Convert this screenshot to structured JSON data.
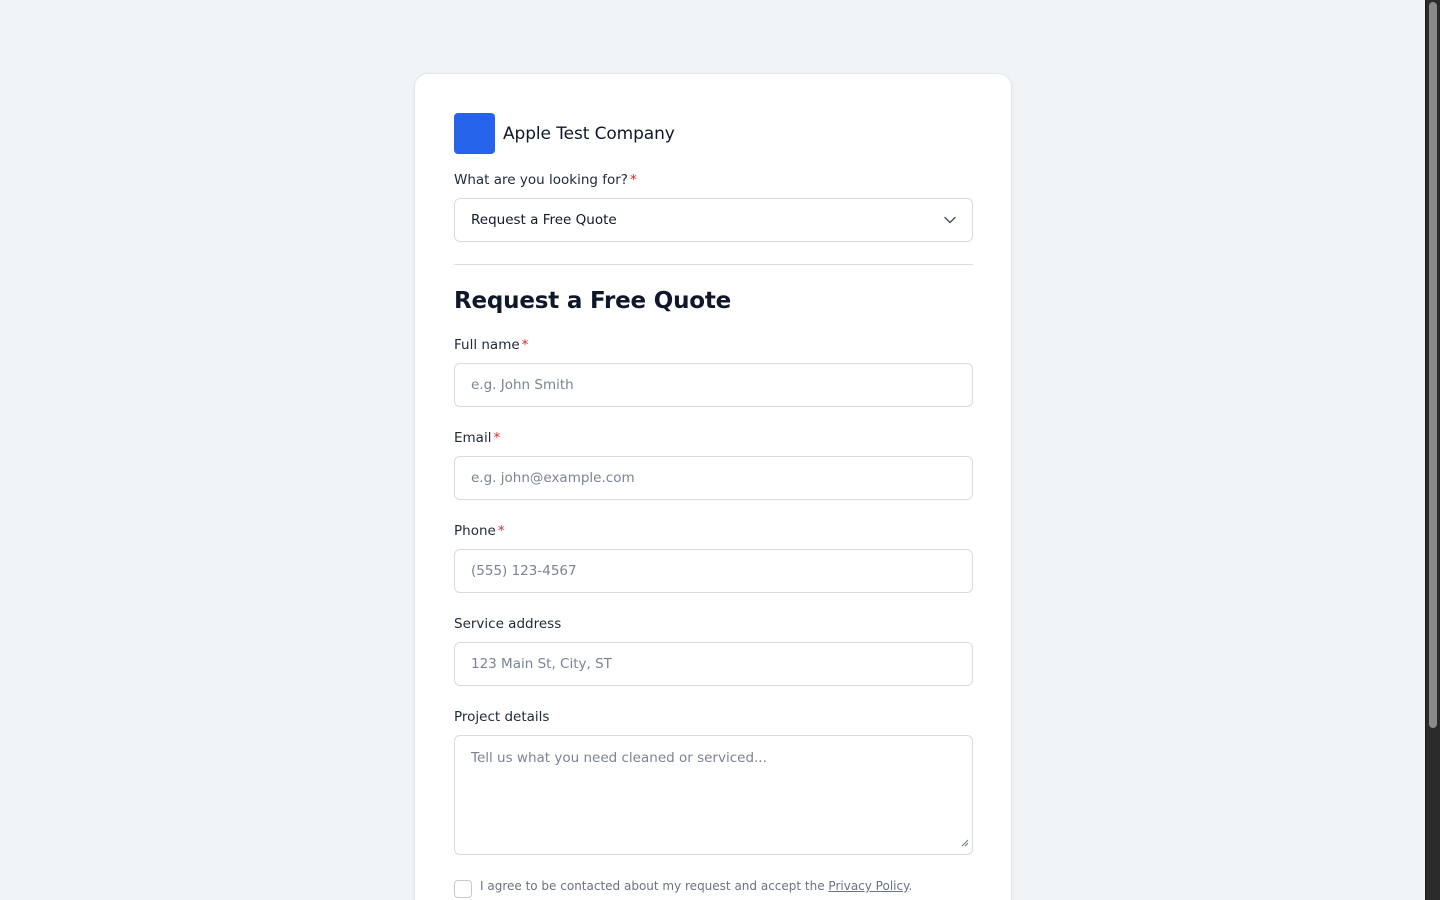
{
  "company": {
    "name": "Apple Test Company",
    "logo_color": "#2563eb"
  },
  "looking_for": {
    "label": "What are you looking for?",
    "required_mark": "*",
    "selected": "Request a Free Quote"
  },
  "section_title": "Request a Free Quote",
  "fields": {
    "full_name": {
      "label": "Full name",
      "required_mark": "*",
      "placeholder": "e.g. John Smith"
    },
    "email": {
      "label": "Email",
      "required_mark": "*",
      "placeholder": "e.g. john@example.com"
    },
    "phone": {
      "label": "Phone",
      "required_mark": "*",
      "placeholder": "(555) 123-4567"
    },
    "address": {
      "label": "Service address",
      "placeholder": "123 Main St, City, ST"
    },
    "details": {
      "label": "Project details",
      "placeholder": "Tell us what you need cleaned or serviced..."
    }
  },
  "consent": {
    "text": "I agree to be contacted about my request and accept the ",
    "link_text": "Privacy Policy",
    "suffix": "."
  },
  "colors": {
    "accent": "#2563eb",
    "required": "#dc2626",
    "background": "#f1f4f7"
  }
}
